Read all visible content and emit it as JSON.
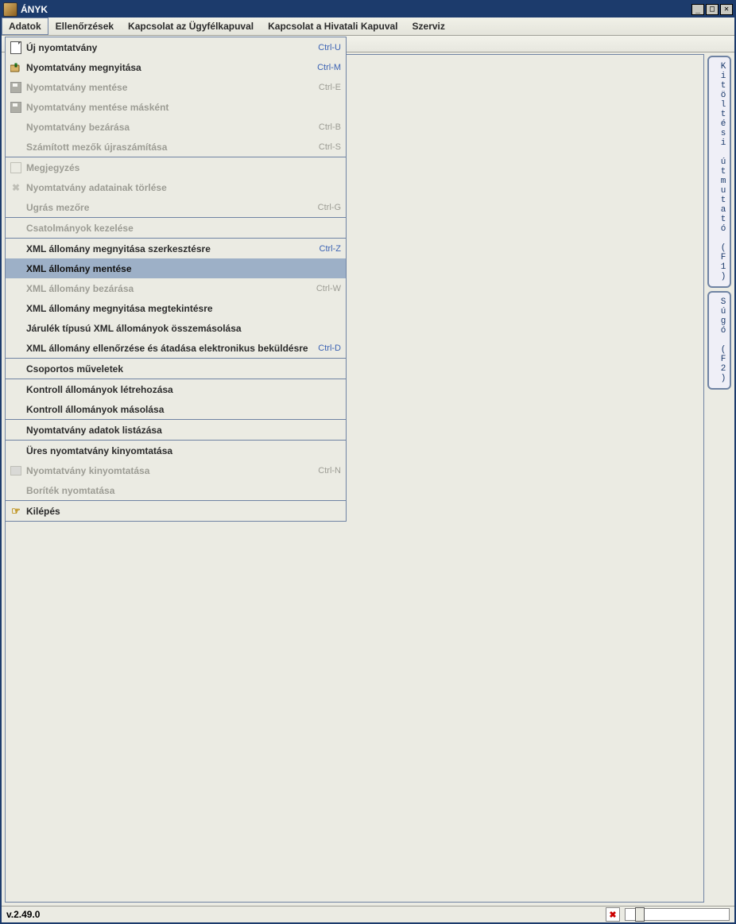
{
  "window": {
    "title": "ÁNYK"
  },
  "menubar": {
    "items": [
      "Adatok",
      "Ellenőrzések",
      "Kapcsolat az Ügyfélkapuval",
      "Kapcsolat a Hivatali Kapuval",
      "Szerviz"
    ],
    "active_index": 0
  },
  "statusbar": {
    "version": "v.2.49.0"
  },
  "sidetabs": {
    "guide": "Kitöltési útmutató (F1)",
    "help": "Súgó (F2)"
  },
  "dropdown": {
    "highlight_index": 11,
    "items": [
      {
        "label": "Új nyomtatvány",
        "accel": "Ctrl-U",
        "enabled": true,
        "icon": "doc-icon"
      },
      {
        "label": "Nyomtatvány megnyitása",
        "accel": "Ctrl-M",
        "enabled": true,
        "icon": "open-icon"
      },
      {
        "label": "Nyomtatvány mentése",
        "accel": "Ctrl-E",
        "enabled": false,
        "icon": "save-icon"
      },
      {
        "label": "Nyomtatvány mentése másként",
        "accel": "",
        "enabled": false,
        "icon": "save-icon"
      },
      {
        "label": "Nyomtatvány bezárása",
        "accel": "Ctrl-B",
        "enabled": false,
        "icon": ""
      },
      {
        "label": "Számított mezők újraszámítása",
        "accel": "Ctrl-S",
        "enabled": false,
        "icon": ""
      },
      {
        "sep": true
      },
      {
        "label": "Megjegyzés",
        "accel": "",
        "enabled": false,
        "icon": "note-icon"
      },
      {
        "label": "Nyomtatvány adatainak törlése",
        "accel": "",
        "enabled": false,
        "icon": "x-icon"
      },
      {
        "label": "Ugrás mezőre",
        "accel": "Ctrl-G",
        "enabled": false,
        "icon": ""
      },
      {
        "sep": true
      },
      {
        "label": "Csatolmányok kezelése",
        "accel": "",
        "enabled": false,
        "icon": ""
      },
      {
        "sep": true
      },
      {
        "label": "XML állomány megnyitása szerkesztésre",
        "accel": "Ctrl-Z",
        "enabled": true,
        "icon": ""
      },
      {
        "label": "XML állomány mentése",
        "accel": "",
        "enabled": false,
        "icon": ""
      },
      {
        "label": "XML állomány bezárása",
        "accel": "Ctrl-W",
        "enabled": false,
        "icon": ""
      },
      {
        "label": "XML állomány megnyitása megtekintésre",
        "accel": "",
        "enabled": true,
        "icon": ""
      },
      {
        "label": "Járulék típusú XML állományok összemásolása",
        "accel": "",
        "enabled": true,
        "icon": ""
      },
      {
        "label": "XML állomány ellenőrzése és átadása elektronikus beküldésre",
        "accel": "Ctrl-D",
        "enabled": true,
        "icon": ""
      },
      {
        "sep": true
      },
      {
        "label": "Csoportos műveletek",
        "accel": "",
        "enabled": true,
        "icon": ""
      },
      {
        "sep": true
      },
      {
        "label": "Kontroll állományok létrehozása",
        "accel": "",
        "enabled": true,
        "icon": ""
      },
      {
        "label": "Kontroll állományok másolása",
        "accel": "",
        "enabled": true,
        "icon": ""
      },
      {
        "sep": true
      },
      {
        "label": "Nyomtatvány adatok listázása",
        "accel": "",
        "enabled": true,
        "icon": ""
      },
      {
        "sep": true
      },
      {
        "label": "Üres nyomtatvány kinyomtatása",
        "accel": "",
        "enabled": true,
        "icon": ""
      },
      {
        "label": "Nyomtatvány kinyomtatása",
        "accel": "Ctrl-N",
        "enabled": false,
        "icon": "print-icon"
      },
      {
        "label": "Boríték nyomtatása",
        "accel": "",
        "enabled": false,
        "icon": ""
      },
      {
        "sep": true
      },
      {
        "label": "Kilépés",
        "accel": "",
        "enabled": true,
        "icon": "exit-icon"
      }
    ]
  }
}
